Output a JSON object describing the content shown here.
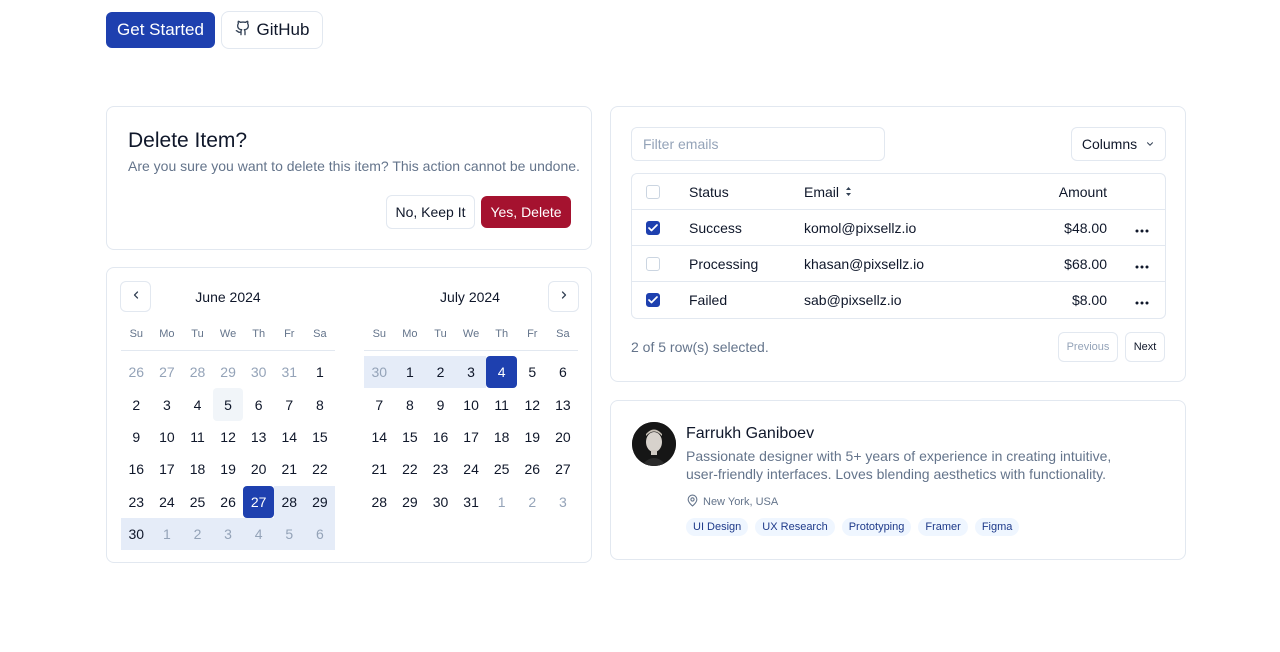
{
  "hero": {
    "primary_label": "Get Started",
    "github_label": "GitHub"
  },
  "dialog": {
    "title": "Delete Item?",
    "description": "Are you sure you want to delete this item? This action cannot be undone.",
    "cancel_label": "No, Keep It",
    "confirm_label": "Yes, Delete"
  },
  "calendar": {
    "weekdays": [
      "Su",
      "Mo",
      "Tu",
      "We",
      "Th",
      "Fr",
      "Sa"
    ],
    "months": [
      {
        "title": "June 2024",
        "days": [
          {
            "d": "26",
            "s": "out"
          },
          {
            "d": "27",
            "s": "out"
          },
          {
            "d": "28",
            "s": "out"
          },
          {
            "d": "29",
            "s": "out"
          },
          {
            "d": "30",
            "s": "out"
          },
          {
            "d": "31",
            "s": "out"
          },
          {
            "d": "1",
            "s": ""
          },
          {
            "d": "2",
            "s": ""
          },
          {
            "d": "3",
            "s": ""
          },
          {
            "d": "4",
            "s": ""
          },
          {
            "d": "5",
            "s": "today"
          },
          {
            "d": "6",
            "s": ""
          },
          {
            "d": "7",
            "s": ""
          },
          {
            "d": "8",
            "s": ""
          },
          {
            "d": "9",
            "s": ""
          },
          {
            "d": "10",
            "s": ""
          },
          {
            "d": "11",
            "s": ""
          },
          {
            "d": "12",
            "s": ""
          },
          {
            "d": "13",
            "s": ""
          },
          {
            "d": "14",
            "s": ""
          },
          {
            "d": "15",
            "s": ""
          },
          {
            "d": "16",
            "s": ""
          },
          {
            "d": "17",
            "s": ""
          },
          {
            "d": "18",
            "s": ""
          },
          {
            "d": "19",
            "s": ""
          },
          {
            "d": "20",
            "s": ""
          },
          {
            "d": "21",
            "s": ""
          },
          {
            "d": "22",
            "s": ""
          },
          {
            "d": "23",
            "s": ""
          },
          {
            "d": "24",
            "s": ""
          },
          {
            "d": "25",
            "s": ""
          },
          {
            "d": "26",
            "s": ""
          },
          {
            "d": "27",
            "s": "sel"
          },
          {
            "d": "28",
            "s": "range"
          },
          {
            "d": "29",
            "s": "range"
          },
          {
            "d": "30",
            "s": "range"
          },
          {
            "d": "1",
            "s": "range out"
          },
          {
            "d": "2",
            "s": "range out"
          },
          {
            "d": "3",
            "s": "range out"
          },
          {
            "d": "4",
            "s": "range out"
          },
          {
            "d": "5",
            "s": "range out"
          },
          {
            "d": "6",
            "s": "range out"
          }
        ]
      },
      {
        "title": "July 2024",
        "days": [
          {
            "d": "30",
            "s": "range out"
          },
          {
            "d": "1",
            "s": "range"
          },
          {
            "d": "2",
            "s": "range"
          },
          {
            "d": "3",
            "s": "range"
          },
          {
            "d": "4",
            "s": "sel"
          },
          {
            "d": "5",
            "s": ""
          },
          {
            "d": "6",
            "s": ""
          },
          {
            "d": "7",
            "s": ""
          },
          {
            "d": "8",
            "s": ""
          },
          {
            "d": "9",
            "s": ""
          },
          {
            "d": "10",
            "s": ""
          },
          {
            "d": "11",
            "s": ""
          },
          {
            "d": "12",
            "s": ""
          },
          {
            "d": "13",
            "s": ""
          },
          {
            "d": "14",
            "s": ""
          },
          {
            "d": "15",
            "s": ""
          },
          {
            "d": "16",
            "s": ""
          },
          {
            "d": "17",
            "s": ""
          },
          {
            "d": "18",
            "s": ""
          },
          {
            "d": "19",
            "s": ""
          },
          {
            "d": "20",
            "s": ""
          },
          {
            "d": "21",
            "s": ""
          },
          {
            "d": "22",
            "s": ""
          },
          {
            "d": "23",
            "s": ""
          },
          {
            "d": "24",
            "s": ""
          },
          {
            "d": "25",
            "s": ""
          },
          {
            "d": "26",
            "s": ""
          },
          {
            "d": "27",
            "s": ""
          },
          {
            "d": "28",
            "s": ""
          },
          {
            "d": "29",
            "s": ""
          },
          {
            "d": "30",
            "s": ""
          },
          {
            "d": "31",
            "s": ""
          },
          {
            "d": "1",
            "s": "out"
          },
          {
            "d": "2",
            "s": "out"
          },
          {
            "d": "3",
            "s": "out"
          }
        ]
      }
    ]
  },
  "table": {
    "filter_placeholder": "Filter emails",
    "columns_label": "Columns",
    "headers": {
      "status": "Status",
      "email": "Email",
      "amount": "Amount"
    },
    "rows": [
      {
        "checked": true,
        "status": "Success",
        "email": "komol@pixsellz.io",
        "amount": "$48.00"
      },
      {
        "checked": false,
        "status": "Processing",
        "email": "khasan@pixsellz.io",
        "amount": "$68.00"
      },
      {
        "checked": true,
        "status": "Failed",
        "email": "sab@pixsellz.io",
        "amount": "$8.00"
      }
    ],
    "selection_info": "2 of 5 row(s) selected.",
    "previous_label": "Previous",
    "next_label": "Next"
  },
  "profile": {
    "name": "Farrukh Ganiboev",
    "bio": "Passionate designer with 5+ years of experience in creating intuitive, user-friendly interfaces. Loves blending aesthetics with functionality.",
    "location": "New York, USA",
    "tags": [
      "UI Design",
      "UX Research",
      "Prototyping",
      "Framer",
      "Figma"
    ]
  },
  "colors": {
    "primary": "#1e40af",
    "destructive": "#a5122f",
    "range": "#e5ecf8"
  }
}
